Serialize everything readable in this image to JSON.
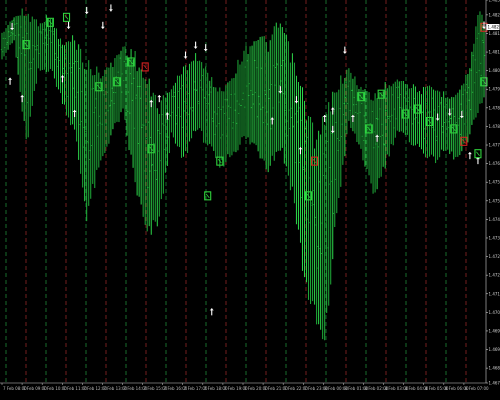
{
  "chart_data": {
    "type": "candlestick",
    "background_color": "#000000",
    "axis_color": "#cfcfcf",
    "bar_color": "#1fae3a",
    "bar_highlight_color": "#2cd84a",
    "separator_colors": [
      "#2bb34a",
      "#c03232"
    ],
    "signal_colors": {
      "buy_box": "#2fd13c",
      "sell_box": "#d62020",
      "arrow": "#ffffff"
    },
    "grid": true,
    "y_axis": {
      "range": [
        1.46775,
        1.4832
      ],
      "ticks": [
        {
          "v": 1.4832,
          "label": "1.48320"
        },
        {
          "v": 1.4826,
          "label": "1.48260"
        },
        {
          "v": 1.48185,
          "label": "1.48185"
        },
        {
          "v": 1.4811,
          "label": "1.48110"
        },
        {
          "v": 1.48035,
          "label": "1.48035"
        },
        {
          "v": 1.4796,
          "label": "1.47960"
        },
        {
          "v": 1.47885,
          "label": "1.47885"
        },
        {
          "v": 1.4781,
          "label": "1.47810"
        },
        {
          "v": 1.47735,
          "label": "1.47735"
        },
        {
          "v": 1.4766,
          "label": "1.47660"
        },
        {
          "v": 1.47585,
          "label": "1.47585"
        },
        {
          "v": 1.4751,
          "label": "1.47510"
        },
        {
          "v": 1.47435,
          "label": "1.47435"
        },
        {
          "v": 1.4736,
          "label": "1.47360"
        },
        {
          "v": 1.47285,
          "label": "1.47285"
        },
        {
          "v": 1.4721,
          "label": "1.47210"
        },
        {
          "v": 1.47135,
          "label": "1.47135"
        },
        {
          "v": 1.4706,
          "label": "1.47060"
        },
        {
          "v": 1.46985,
          "label": "1.46985"
        },
        {
          "v": 1.4691,
          "label": "1.46910"
        },
        {
          "v": 1.46835,
          "label": "1.46835"
        },
        {
          "v": 1.46775,
          "label": "1.46775"
        }
      ],
      "current_price": {
        "v": 1.48211,
        "label": "1.48211"
      }
    },
    "x_ticks": [
      "7 Feb 08:00",
      "7 Feb 09:00",
      "7 Feb 10:00",
      "7 Feb 11:00",
      "7 Feb 12:00",
      "7 Feb 13:00",
      "7 Feb 14:00",
      "7 Feb 15:00",
      "7 Feb 16:00",
      "7 Feb 17:00",
      "7 Feb 18:00",
      "7 Feb 19:00",
      "7 Feb 20:00",
      "7 Feb 21:00",
      "7 Feb 22:00",
      "7 Feb 23:00",
      "8 Feb 00:00",
      "8 Feb 01:00",
      "8 Feb 02:00",
      "8 Feb 03:00",
      "8 Feb 04:00",
      "8 Feb 05:00",
      "8 Feb 06:00",
      "8 Feb 07:00"
    ],
    "bars": {
      "count": 240,
      "high_low_keypoints": [
        {
          "i": 0,
          "high": 1.4819,
          "low": 1.4808
        },
        {
          "i": 6,
          "high": 1.4826,
          "low": 1.4815
        },
        {
          "i": 12,
          "high": 1.483,
          "low": 1.477
        },
        {
          "i": 18,
          "high": 1.4824,
          "low": 1.4802
        },
        {
          "i": 24,
          "high": 1.4827,
          "low": 1.4803
        },
        {
          "i": 30,
          "high": 1.4815,
          "low": 1.479
        },
        {
          "i": 36,
          "high": 1.4819,
          "low": 1.4776
        },
        {
          "i": 42,
          "high": 1.4809,
          "low": 1.4742
        },
        {
          "i": 48,
          "high": 1.4805,
          "low": 1.4761
        },
        {
          "i": 54,
          "high": 1.4807,
          "low": 1.4776
        },
        {
          "i": 60,
          "high": 1.4815,
          "low": 1.4785
        },
        {
          "i": 66,
          "high": 1.4812,
          "low": 1.4755
        },
        {
          "i": 72,
          "high": 1.4802,
          "low": 1.4732
        },
        {
          "i": 78,
          "high": 1.4792,
          "low": 1.4741
        },
        {
          "i": 84,
          "high": 1.4798,
          "low": 1.4776
        },
        {
          "i": 90,
          "high": 1.4806,
          "low": 1.4765
        },
        {
          "i": 96,
          "high": 1.4812,
          "low": 1.4779
        },
        {
          "i": 102,
          "high": 1.4804,
          "low": 1.4772
        },
        {
          "i": 108,
          "high": 1.4797,
          "low": 1.4763
        },
        {
          "i": 114,
          "high": 1.4803,
          "low": 1.4768
        },
        {
          "i": 120,
          "high": 1.4813,
          "low": 1.4774
        },
        {
          "i": 126,
          "high": 1.482,
          "low": 1.477
        },
        {
          "i": 132,
          "high": 1.4817,
          "low": 1.4762
        },
        {
          "i": 138,
          "high": 1.4826,
          "low": 1.477
        },
        {
          "i": 144,
          "high": 1.4811,
          "low": 1.4752
        },
        {
          "i": 150,
          "high": 1.4795,
          "low": 1.4715
        },
        {
          "i": 156,
          "high": 1.4779,
          "low": 1.4697
        },
        {
          "i": 160,
          "high": 1.4788,
          "low": 1.4686
        },
        {
          "i": 166,
          "high": 1.4801,
          "low": 1.4743
        },
        {
          "i": 172,
          "high": 1.4805,
          "low": 1.4781
        },
        {
          "i": 178,
          "high": 1.4798,
          "low": 1.477
        },
        {
          "i": 184,
          "high": 1.4795,
          "low": 1.475
        },
        {
          "i": 190,
          "high": 1.4799,
          "low": 1.4764
        },
        {
          "i": 196,
          "high": 1.4802,
          "low": 1.4778
        },
        {
          "i": 202,
          "high": 1.4799,
          "low": 1.4774
        },
        {
          "i": 208,
          "high": 1.4797,
          "low": 1.477
        },
        {
          "i": 214,
          "high": 1.4798,
          "low": 1.4765
        },
        {
          "i": 220,
          "high": 1.4795,
          "low": 1.477
        },
        {
          "i": 226,
          "high": 1.4796,
          "low": 1.4766
        },
        {
          "i": 232,
          "high": 1.4806,
          "low": 1.4775
        },
        {
          "i": 236,
          "high": 1.483,
          "low": 1.4786
        },
        {
          "i": 239,
          "high": 1.4826,
          "low": 1.479
        }
      ]
    },
    "signals": [
      {
        "type": "arrow-up",
        "i": 4,
        "price": 1.4799
      },
      {
        "type": "arrow-down",
        "i": 5,
        "price": 1.48215
      },
      {
        "type": "arrow-up",
        "i": 10,
        "price": 1.4792
      },
      {
        "type": "buy-box",
        "i": 12,
        "price": 1.4814
      },
      {
        "type": "buy-box",
        "i": 24,
        "price": 1.4823
      },
      {
        "type": "arrow-up",
        "i": 30,
        "price": 1.48
      },
      {
        "type": "buy-box",
        "i": 32,
        "price": 1.4825
      },
      {
        "type": "arrow-down",
        "i": 33,
        "price": 1.4822
      },
      {
        "type": "arrow-up",
        "i": 36,
        "price": 1.4786
      },
      {
        "type": "arrow-down",
        "i": 42,
        "price": 1.4828
      },
      {
        "type": "buy-box",
        "i": 48,
        "price": 1.4797
      },
      {
        "type": "arrow-down",
        "i": 50,
        "price": 1.4822
      },
      {
        "type": "arrow-down",
        "i": 54,
        "price": 1.4829
      },
      {
        "type": "buy-box",
        "i": 57,
        "price": 1.4799
      },
      {
        "type": "buy-box",
        "i": 64,
        "price": 1.4807
      },
      {
        "type": "sell-box",
        "i": 71,
        "price": 1.4805
      },
      {
        "type": "arrow-up",
        "i": 74,
        "price": 1.479
      },
      {
        "type": "buy-box",
        "i": 74,
        "price": 1.4772
      },
      {
        "type": "arrow-up",
        "i": 78,
        "price": 1.4792
      },
      {
        "type": "arrow-up",
        "i": 82,
        "price": 1.4785
      },
      {
        "type": "arrow-down",
        "i": 91,
        "price": 1.481
      },
      {
        "type": "arrow-down",
        "i": 96,
        "price": 1.4814
      },
      {
        "type": "arrow-down",
        "i": 101,
        "price": 1.4813
      },
      {
        "type": "buy-box",
        "i": 108,
        "price": 1.4767
      },
      {
        "type": "buy-box",
        "i": 102,
        "price": 1.4753
      },
      {
        "type": "arrow-up",
        "i": 104,
        "price": 1.4706
      },
      {
        "type": "arrow-up",
        "i": 134,
        "price": 1.4783
      },
      {
        "type": "arrow-down",
        "i": 138,
        "price": 1.4796
      },
      {
        "type": "arrow-up",
        "i": 148,
        "price": 1.4771
      },
      {
        "type": "arrow-down",
        "i": 146,
        "price": 1.4792
      },
      {
        "type": "buy-box",
        "i": 152,
        "price": 1.4753
      },
      {
        "type": "sell-box",
        "i": 155,
        "price": 1.4767
      },
      {
        "type": "arrow-up",
        "i": 160,
        "price": 1.4784
      },
      {
        "type": "arrow-down",
        "i": 164,
        "price": 1.478
      },
      {
        "type": "arrow-down",
        "i": 170,
        "price": 1.4812
      },
      {
        "type": "arrow-up",
        "i": 174,
        "price": 1.4784
      },
      {
        "type": "arrow-up",
        "i": 164,
        "price": 1.4787
      },
      {
        "type": "buy-box",
        "i": 178,
        "price": 1.4793
      },
      {
        "type": "buy-box",
        "i": 182,
        "price": 1.478
      },
      {
        "type": "arrow-up",
        "i": 186,
        "price": 1.4776
      },
      {
        "type": "buy-box",
        "i": 188,
        "price": 1.4794
      },
      {
        "type": "buy-box",
        "i": 200,
        "price": 1.4786
      },
      {
        "type": "buy-box",
        "i": 206,
        "price": 1.4788
      },
      {
        "type": "buy-box",
        "i": 212,
        "price": 1.4783
      },
      {
        "type": "arrow-down",
        "i": 216,
        "price": 1.4785
      },
      {
        "type": "arrow-down",
        "i": 222,
        "price": 1.4787
      },
      {
        "type": "arrow-down",
        "i": 228,
        "price": 1.4786
      },
      {
        "type": "buy-box",
        "i": 224,
        "price": 1.478
      },
      {
        "type": "sell-box",
        "i": 229,
        "price": 1.4775
      },
      {
        "type": "arrow-up",
        "i": 232,
        "price": 1.4769
      },
      {
        "type": "arrow-up",
        "i": 236,
        "price": 1.4767
      },
      {
        "type": "buy-box",
        "i": 236,
        "price": 1.477
      },
      {
        "type": "sell-box",
        "i": 239,
        "price": 1.4821
      },
      {
        "type": "arrow-down",
        "i": 239,
        "price": 1.4822
      },
      {
        "type": "buy-box",
        "i": 239,
        "price": 1.4799
      }
    ]
  }
}
